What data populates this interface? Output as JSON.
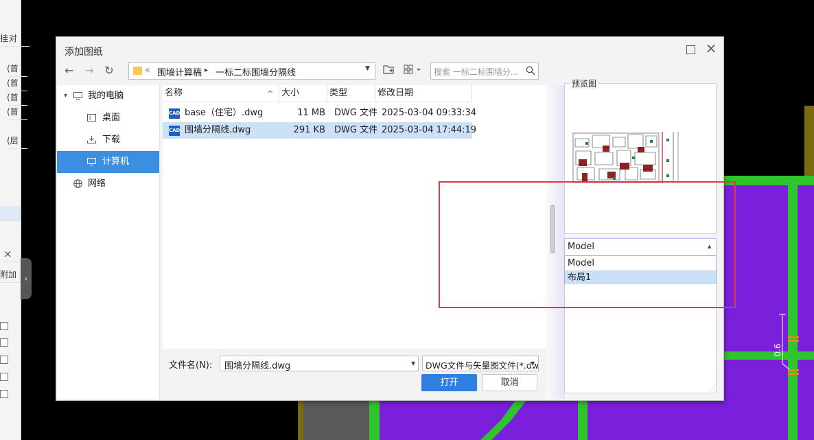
{
  "background": {
    "left_cells": [
      "挂",
      "对",
      "(首",
      "(首",
      "(首",
      "(首",
      "(层"
    ],
    "panel_close": "×",
    "panel_add": "附加",
    "collapse_glyph": "‹",
    "cad_dimension": "0.6",
    "colors": {
      "purple": "#7a1fdc",
      "green": "#2ec52e",
      "gray": "#555555"
    }
  },
  "dialog": {
    "title": "添加图纸",
    "maximize_icon": "maximize-icon",
    "close_glyph": "×",
    "nav": {
      "back": "←",
      "forward": "→",
      "refresh": "↻"
    },
    "address": {
      "overflow": "«",
      "crumbs": [
        "围墙计算稿",
        "一标二标围墙分隔线"
      ],
      "separator": "▸"
    },
    "search": {
      "placeholder": "搜索 一标二标围墙分..."
    },
    "nav_pane": [
      {
        "label": "我的电脑",
        "icon": "computer-icon",
        "expander": "▾"
      },
      {
        "label": "桌面",
        "icon": "desktop-icon"
      },
      {
        "label": "下载",
        "icon": "download-icon"
      },
      {
        "label": "计算机",
        "icon": "computer-icon",
        "selected": true
      },
      {
        "label": "网络",
        "icon": "network-icon"
      }
    ],
    "columns": {
      "name": "名称",
      "size": "大小",
      "type": "类型",
      "modified": "修改日期",
      "sort_glyph": "^"
    },
    "files": [
      {
        "icon": "CAD",
        "name": "base（住宅）.dwg",
        "size": "11 MB",
        "type": "DWG 文件",
        "modified": "2025-03-04 09:33:34",
        "selected": false
      },
      {
        "icon": "CAD",
        "name": "围墙分隔线.dwg",
        "size": "291 KB",
        "type": "DWG 文件",
        "modified": "2025-03-04 17:44:19",
        "selected": true
      }
    ],
    "filename_label": "文件名(N):",
    "filename_value": "围墙分隔线.dwg",
    "filter_value": "DWG文件与矢量图文件(*.dwg",
    "open_label": "打开",
    "cancel_label": "取消",
    "preview": {
      "label": "预览图",
      "layout_value": "Model",
      "options": [
        "Model",
        "布局1"
      ],
      "highlighted_option": 1
    },
    "highlight_color": "#e53935",
    "accent": "#2f7fe0"
  }
}
